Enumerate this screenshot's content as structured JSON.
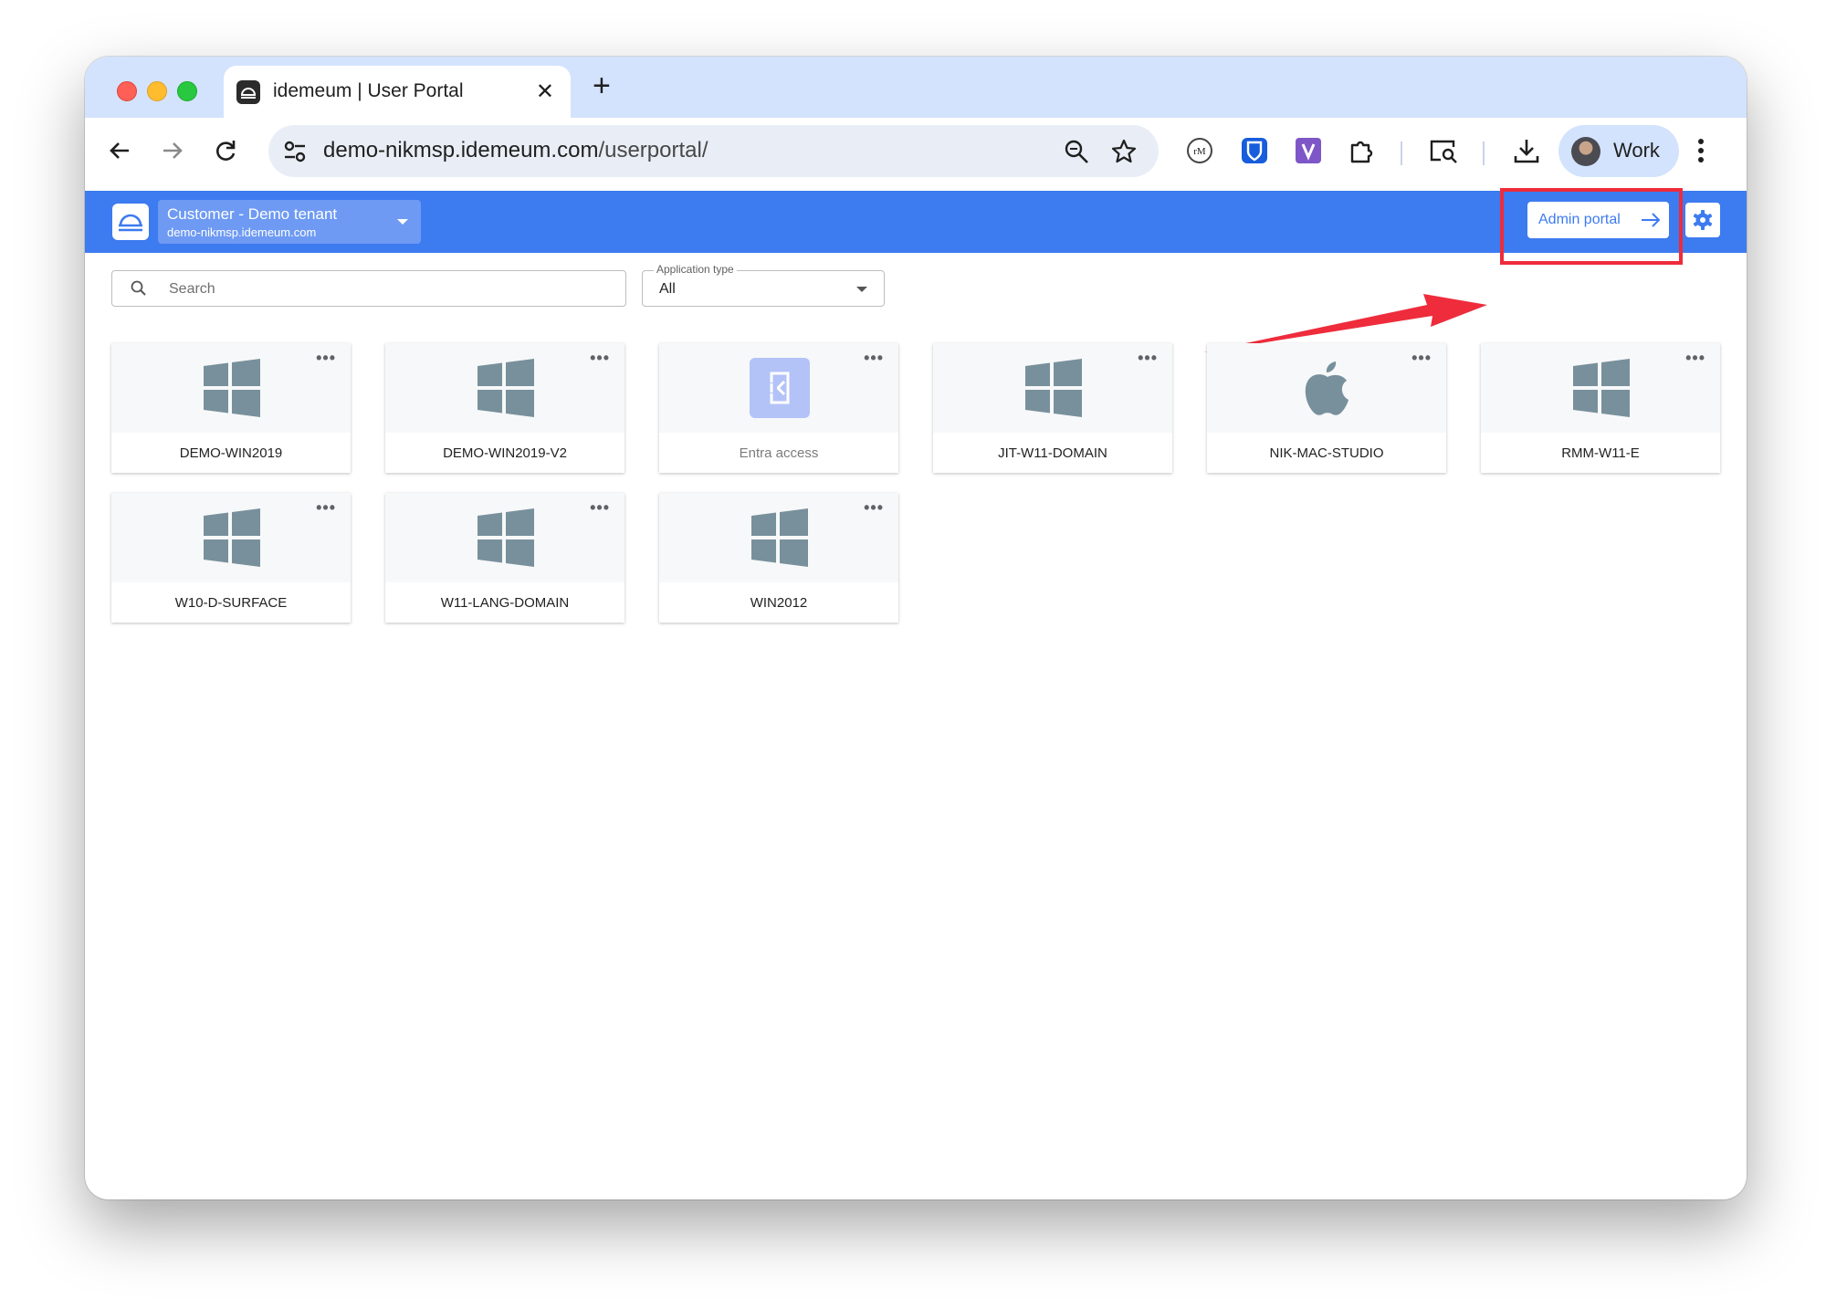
{
  "browser": {
    "tab_title": "idemeum | User Portal",
    "url_host": "demo-nikmsp.idemeum.com",
    "url_path": "/userportal/",
    "profile_label": "Work"
  },
  "header": {
    "tenant_name": "Customer - Demo tenant",
    "tenant_domain": "demo-nikmsp.idemeum.com",
    "admin_button_label": "Admin portal"
  },
  "filters": {
    "search_placeholder": "Search",
    "app_type_label": "Application type",
    "app_type_value": "All"
  },
  "apps": [
    {
      "name": "DEMO-WIN2019",
      "icon": "windows-icon"
    },
    {
      "name": "DEMO-WIN2019-V2",
      "icon": "windows-icon"
    },
    {
      "name": "Entra access",
      "icon": "entra-icon"
    },
    {
      "name": "JIT-W11-DOMAIN",
      "icon": "windows-icon"
    },
    {
      "name": "NIK-MAC-STUDIO",
      "icon": "apple-icon"
    },
    {
      "name": "RMM-W11-E",
      "icon": "windows-icon"
    },
    {
      "name": "W10-D-SURFACE",
      "icon": "windows-icon"
    },
    {
      "name": "W11-LANG-DOMAIN",
      "icon": "windows-icon"
    },
    {
      "name": "WIN2012",
      "icon": "windows-icon"
    }
  ],
  "colors": {
    "header_blue": "#3d7bf0",
    "annotation_red": "#ee2c3c",
    "icon_gray": "#78909c"
  }
}
